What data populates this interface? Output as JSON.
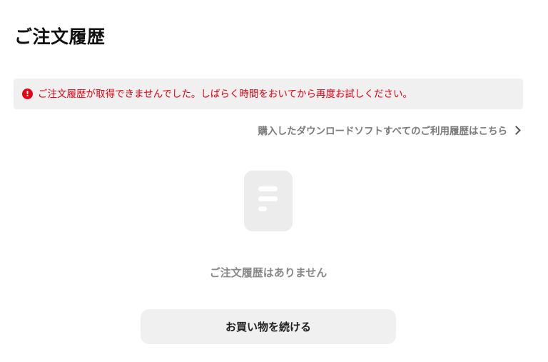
{
  "page": {
    "title": "ご注文履歴"
  },
  "error_banner": {
    "icon": "exclamation-circle-icon",
    "icon_glyph": "!",
    "message": "ご注文履歴が取得できませんでした。しばらく時間をおいてから再度お試しください。",
    "color": "#e60012"
  },
  "history_link": {
    "label": "購入したダウンロードソフトすべてのご利用履歴はこちら",
    "icon": "chevron-right-icon"
  },
  "empty_state": {
    "icon": "document-icon",
    "message": "ご注文履歴はありません"
  },
  "continue_button": {
    "label": "お買い物を続ける"
  }
}
